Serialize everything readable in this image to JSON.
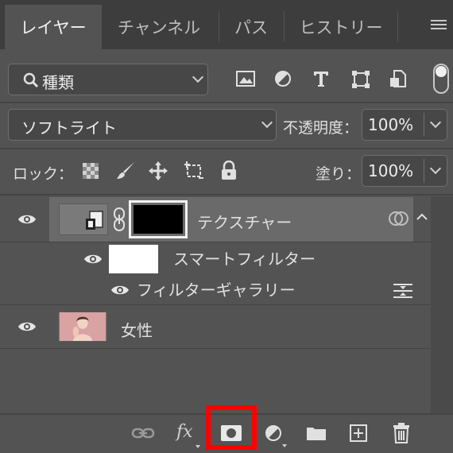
{
  "tabs": [
    {
      "label": "レイヤー",
      "active": true
    },
    {
      "label": "チャンネル",
      "active": false
    },
    {
      "label": "パス",
      "active": false
    },
    {
      "label": "ヒストリー",
      "active": false
    }
  ],
  "filter": {
    "kind_label": "種類",
    "filter_icons": [
      "image-filter-icon",
      "adjustment-filter-icon",
      "type-filter-icon",
      "shape-filter-icon",
      "smart-object-filter-icon"
    ]
  },
  "blend": {
    "mode": "ソフトライト",
    "opacity_label": "不透明度：",
    "opacity_value": "100%"
  },
  "lock": {
    "label": "ロック：",
    "fill_label": "塗り：",
    "fill_value": "100%"
  },
  "layers": {
    "texture": {
      "name": "テクスチャー"
    },
    "smart_filter": {
      "name": "スマートフィルター"
    },
    "filter_gallery": {
      "name": "フィルターギャラリー"
    },
    "woman": {
      "name": "女性"
    }
  },
  "bottom_toolbar": {
    "fx_label": "fx"
  },
  "colors": {
    "panel": "#535353",
    "selected_row": "#6a6a6a",
    "highlight": "#ff0000"
  }
}
